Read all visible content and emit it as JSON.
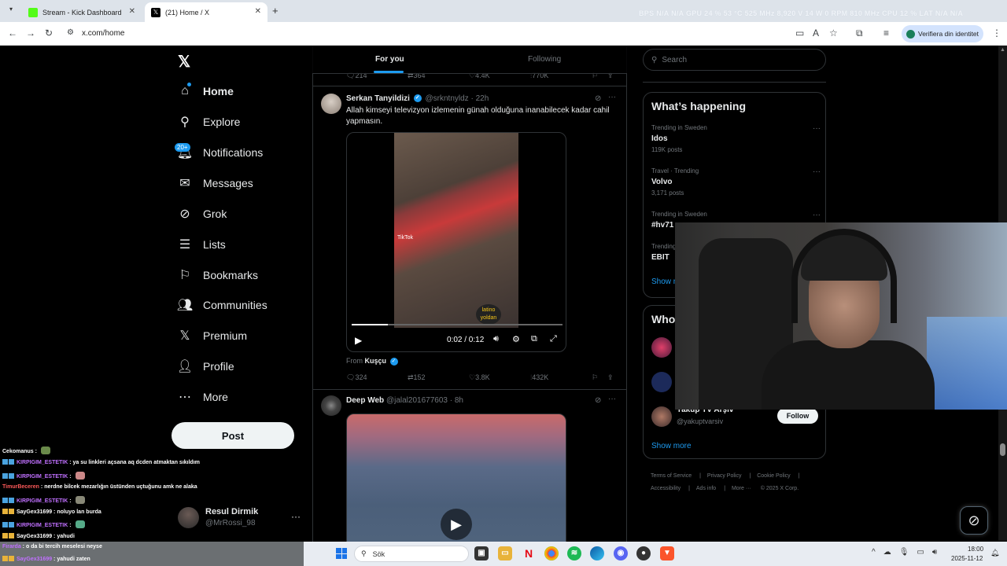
{
  "browser": {
    "tabs": [
      {
        "title": "Stream - Kick Dashboard",
        "favicon_color": "#53fc18"
      },
      {
        "title": "(21) Home / X",
        "favicon_color": "#000000"
      }
    ],
    "url": "x.com/home",
    "hw_stats": "BPS N/A N/A   GPU 24 % 53 °C 525 MHz 8,920 V 14 W 0 RPM 810 MHz   CPU 12 %   LAT N/A N/A",
    "profile_chip": "Verifiera din identitet"
  },
  "nav": {
    "items": [
      {
        "label": "Home",
        "icon": "home-icon"
      },
      {
        "label": "Explore",
        "icon": "search-icon"
      },
      {
        "label": "Notifications",
        "icon": "bell-icon"
      },
      {
        "label": "Messages",
        "icon": "mail-icon"
      },
      {
        "label": "Grok",
        "icon": "grok-icon"
      },
      {
        "label": "Lists",
        "icon": "list-icon"
      },
      {
        "label": "Bookmarks",
        "icon": "bookmark-icon"
      },
      {
        "label": "Communities",
        "icon": "people-icon"
      },
      {
        "label": "Premium",
        "icon": "x-icon"
      },
      {
        "label": "Profile",
        "icon": "person-icon"
      },
      {
        "label": "More",
        "icon": "more-circle-icon"
      }
    ],
    "notifications_badge": "20+",
    "post_label": "Post",
    "user": {
      "name": "Resul Dirmik",
      "handle": "@MrRossi_98"
    }
  },
  "feed": {
    "tabs": [
      "For you",
      "Following"
    ],
    "prev_actions": {
      "replies": "214",
      "reposts": "364",
      "likes": "4.4K",
      "views": "770K"
    },
    "tweets": [
      {
        "name": "Serkan Tanyildizi",
        "handle": "@srkntnyldz",
        "time": "22h",
        "text": "Allah kimseyi televizyon izlemenin günah olduğuna inanabilecek kadar cahil yapmasın.",
        "video_time": "0:02 / 0:12",
        "video_progress": 0.17,
        "watermark": "TikTok",
        "sticker": "latino yoldan",
        "from_label": "From",
        "from_name": "Kuşçu",
        "replies": "324",
        "reposts": "152",
        "likes": "3.8K",
        "views": "432K"
      },
      {
        "name": "Deep Web",
        "handle": "@jalal201677603",
        "time": "8h"
      }
    ]
  },
  "sidebar": {
    "search_placeholder": "Search",
    "happening_title": "What’s happening",
    "trends": [
      {
        "context": "Trending in Sweden",
        "topic": "Idos",
        "count": "119K posts"
      },
      {
        "context": "Travel · Trending",
        "topic": "Volvo",
        "count": "3,171 posts"
      },
      {
        "context": "Trending in Sweden",
        "topic": "#hv71",
        "count": ""
      },
      {
        "context": "Trending",
        "topic": "EBIT",
        "count": ""
      }
    ],
    "show_more": "Show more",
    "who_title": "Who",
    "who_user": {
      "name": "Yakup TV Arşiv",
      "handle": "@yakuptvarsiv"
    },
    "follow_label": "Follow",
    "footer": [
      "Terms of Service",
      "Privacy Policy",
      "Cookie Policy",
      "Accessibility",
      "Ads info",
      "More ···",
      "© 2025 X Corp."
    ]
  },
  "chat": [
    {
      "user": "Cekomanus",
      "message": "",
      "color": "white"
    },
    {
      "user": "KIRPIGIM_ESTETIK",
      "message": "ya su linkleri açsana aq dcden atmaktan sıkıldım",
      "color": "purple"
    },
    {
      "user": "KIRPIGIM_ESTETIK",
      "message": "",
      "color": "purple"
    },
    {
      "user": "TimurBeceren",
      "message": "nerdne bilcek mezarlığın üstünden uçtuğunu amk ne alaka",
      "color": "red"
    },
    {
      "user": "KIRPIGIM_ESTETIK",
      "message": "",
      "color": "purple"
    },
    {
      "user": "SayGex31699",
      "message": "noluyo lan burda",
      "color": "white"
    },
    {
      "user": "KIRPIGIM_ESTETIK",
      "message": "",
      "color": "purple"
    },
    {
      "user": "SayGex31699",
      "message": "yahudi",
      "color": "white"
    },
    {
      "user": "Firarda",
      "message": "o da bi tercih meselesi neyse",
      "color": "purple"
    },
    {
      "user": "SayGex31699",
      "message": "yahudi zaten",
      "color": "purple"
    }
  ],
  "taskbar": {
    "search_label": "Sök",
    "time": "18:00",
    "date": "2025-11-12"
  },
  "colors": {
    "accent": "#1d9bf0",
    "background": "#000000",
    "border": "#2f3336"
  }
}
